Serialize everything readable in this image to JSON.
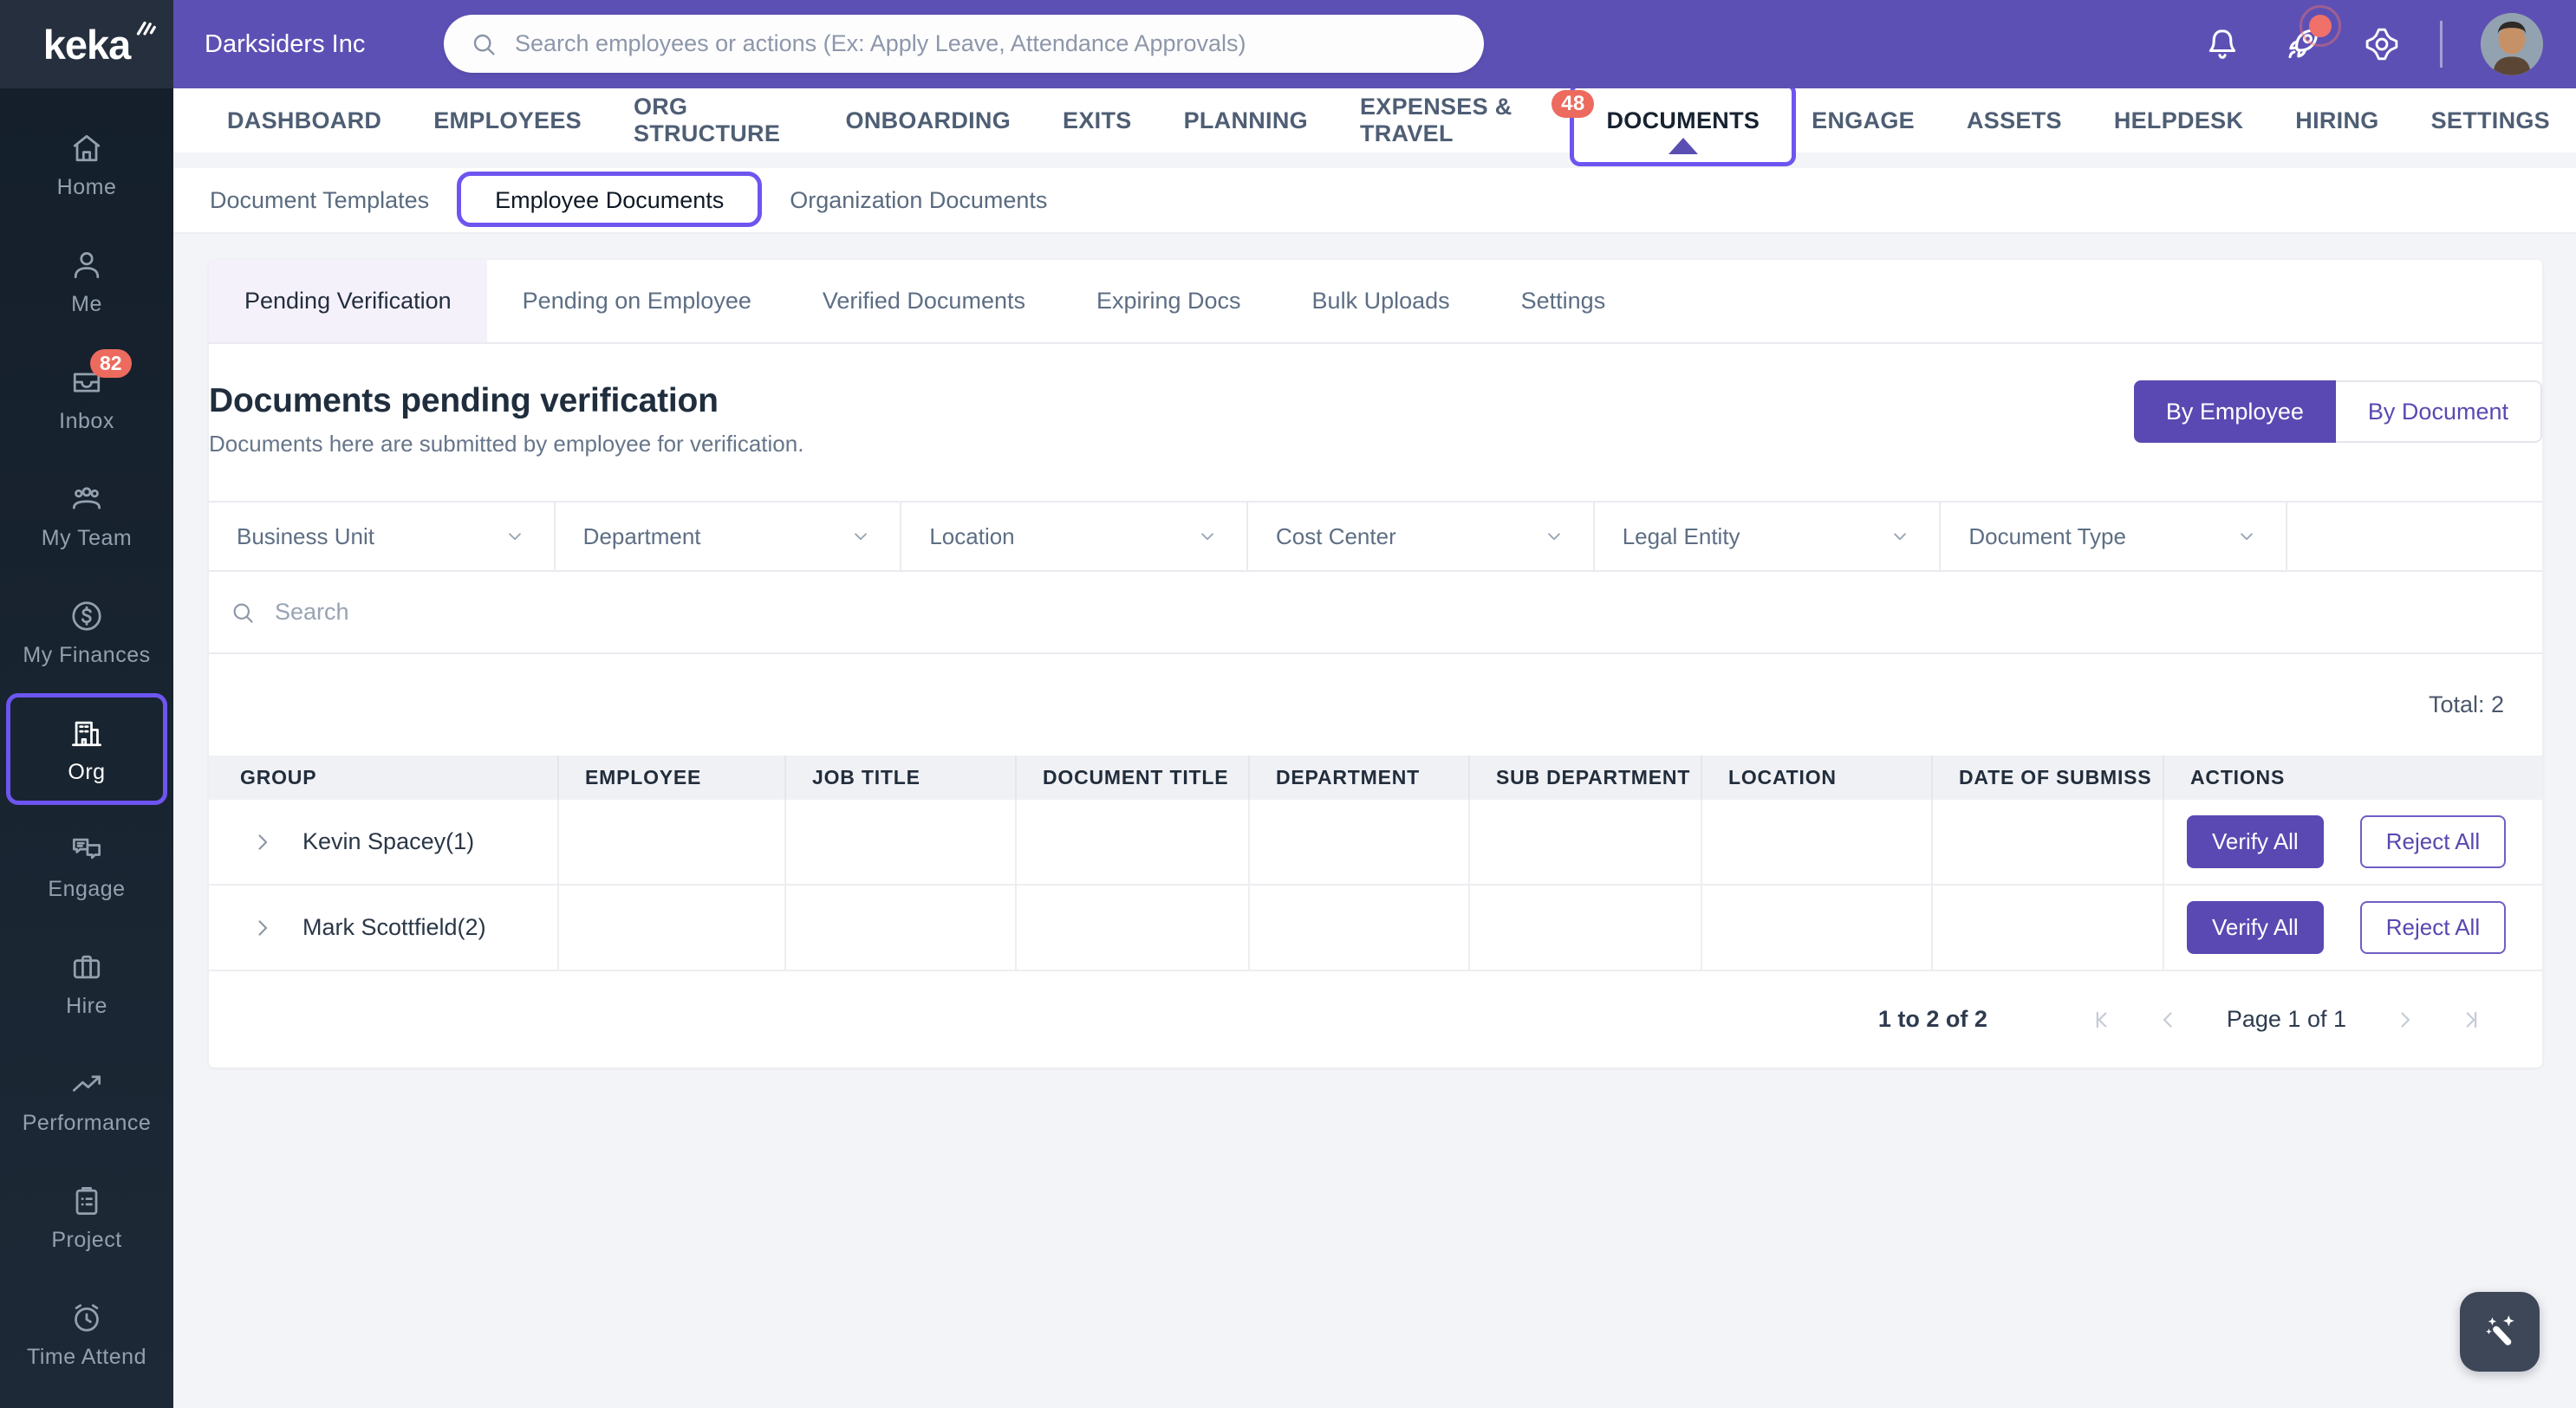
{
  "topbar": {
    "logo_text": "keka",
    "company_name": "Darksiders Inc",
    "search_placeholder": "Search employees or actions (Ex: Apply Leave, Attendance Approvals)",
    "icons": {
      "bell": "bell-icon",
      "rocket": "rocket-icon",
      "gear": "gear-icon",
      "avatar": "user-avatar"
    }
  },
  "nav": {
    "items": [
      {
        "label": "DASHBOARD"
      },
      {
        "label": "EMPLOYEES"
      },
      {
        "label": "ORG STRUCTURE"
      },
      {
        "label": "ONBOARDING"
      },
      {
        "label": "EXITS"
      },
      {
        "label": "PLANNING"
      },
      {
        "label": "EXPENSES & TRAVEL",
        "badge": "48"
      },
      {
        "label": "DOCUMENTS",
        "active": true
      },
      {
        "label": "ENGAGE"
      },
      {
        "label": "ASSETS"
      },
      {
        "label": "HELPDESK"
      },
      {
        "label": "HIRING"
      },
      {
        "label": "SETTINGS"
      }
    ]
  },
  "subnav": {
    "items": [
      {
        "label": "Document Templates"
      },
      {
        "label": "Employee Documents",
        "active": true
      },
      {
        "label": "Organization Documents"
      }
    ]
  },
  "sidebar": {
    "items": [
      {
        "label": "Home",
        "icon": "home-icon"
      },
      {
        "label": "Me",
        "icon": "user-icon"
      },
      {
        "label": "Inbox",
        "icon": "inbox-icon",
        "badge": "82"
      },
      {
        "label": "My Team",
        "icon": "team-icon"
      },
      {
        "label": "My Finances",
        "icon": "dollar-icon"
      },
      {
        "label": "Org",
        "icon": "building-icon",
        "active": true
      },
      {
        "label": "Engage",
        "icon": "chat-icon"
      },
      {
        "label": "Hire",
        "icon": "briefcase-icon"
      },
      {
        "label": "Performance",
        "icon": "trend-icon"
      },
      {
        "label": "Project",
        "icon": "clipboard-icon"
      },
      {
        "label": "Time Attend",
        "icon": "alarm-clock-icon"
      }
    ]
  },
  "tabs": {
    "items": [
      {
        "label": "Pending Verification",
        "active": true
      },
      {
        "label": "Pending on Employee"
      },
      {
        "label": "Verified Documents"
      },
      {
        "label": "Expiring Docs"
      },
      {
        "label": "Bulk Uploads"
      },
      {
        "label": "Settings"
      }
    ]
  },
  "page": {
    "title": "Documents pending verification",
    "subtitle": "Documents here are submitted by employee for verification.",
    "toggle": {
      "by_employee": "By Employee",
      "by_document": "By Document"
    },
    "total": "Total: 2"
  },
  "filters": {
    "dropdowns": [
      "Business Unit",
      "Department",
      "Location",
      "Cost Center",
      "Legal Entity",
      "Document Type"
    ],
    "search_placeholder": "Search"
  },
  "table": {
    "headers": [
      "GROUP",
      "EMPLOYEE",
      "JOB TITLE",
      "DOCUMENT TITLE",
      "DEPARTMENT",
      "SUB DEPARTMENT",
      "LOCATION",
      "DATE OF SUBMISS",
      "ACTIONS"
    ],
    "rows": [
      {
        "group": "Kevin Spacey(1)",
        "verify": "Verify All",
        "reject": "Reject All"
      },
      {
        "group": "Mark Scottfield(2)",
        "verify": "Verify All",
        "reject": "Reject All"
      }
    ]
  },
  "pagination": {
    "range": "1 to 2 of 2",
    "page": "Page 1 of 1"
  },
  "colors": {
    "topbar_purple": "#5D50B5",
    "annotation_purple": "#6D55F0",
    "primary_button_purple": "#5A49B2",
    "badge_red": "#ED6A5E",
    "sidebar_dark": "#18232F",
    "active_tab_bg": "#F5F1FB"
  }
}
